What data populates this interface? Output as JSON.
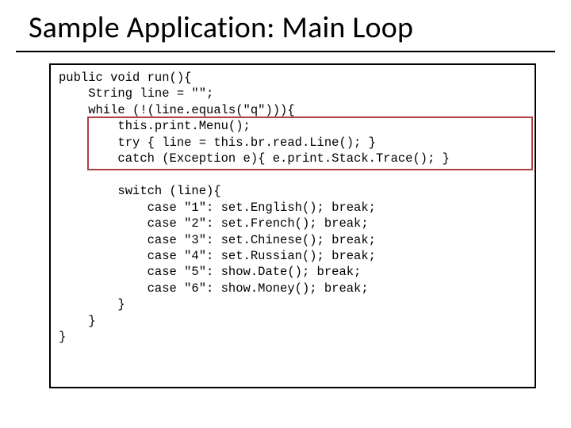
{
  "title": "Sample Application: Main Loop",
  "code": {
    "l01": "public void run(){",
    "l02": "    String line = \"\";",
    "l03": "    while (!(line.equals(\"q\"))){",
    "l04": "        this.print.Menu();",
    "l05": "        try { line = this.br.read.Line(); }",
    "l06": "        catch (Exception e){ e.print.Stack.Trace(); }",
    "l07": "",
    "l08": "        switch (line){",
    "l09": "            case \"1\": set.English(); break;",
    "l10": "            case \"2\": set.French(); break;",
    "l11": "            case \"3\": set.Chinese(); break;",
    "l12": "            case \"4\": set.Russian(); break;",
    "l13": "            case \"5\": show.Date(); break;",
    "l14": "            case \"6\": show.Money(); break;",
    "l15": "        }",
    "l16": "    }",
    "l17": "}"
  }
}
